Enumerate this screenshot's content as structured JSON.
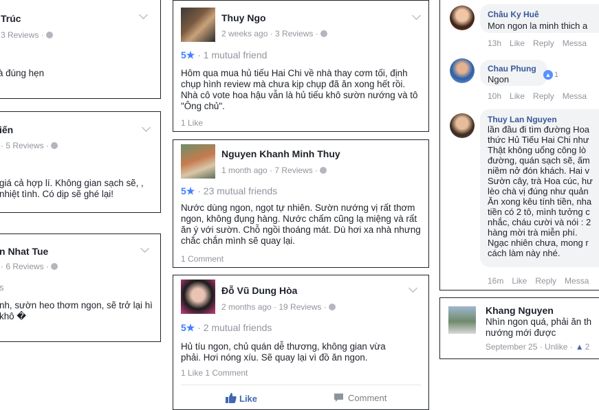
{
  "reviews_left": [
    {
      "name": "Trúc",
      "meta": "3 Reviews ·",
      "body": "à đúng hẹn"
    },
    {
      "name": "iến",
      "meta": "· 5 Reviews ·",
      "body": "giá cả hợp lí. Không gian sạch sẽ, , nhiệt tình. Có dịp sẽ ghé lại!"
    },
    {
      "name": "n Nhat Tue",
      "meta": "· 6 Reviews ·",
      "rating": "s",
      "body": "nh, sườn heo thơm ngon, sẽ trở lại hì khô �"
    }
  ],
  "reviews_mid": [
    {
      "name": "Thuy Ngo",
      "meta": "2 weeks ago · 3 Reviews ·",
      "score": "5★",
      "mutual": " · 1 mutual friend",
      "body": "Hôm qua mua hủ tiếu Hai Chi về nhà thay cơm tối, định chụp hình review mà chưa kịp chụp đã ăn xong hết rồi. Nhà cô vote hoa hậu vẫn là hủ tiếu khô sườn nướng và tô \"Ông chủ\".",
      "footer": "1 Like"
    },
    {
      "name": "Nguyen Khanh Minh Thuy",
      "meta": "1 month ago · 7 Reviews ·",
      "score": "5★",
      "mutual": " · 23 mutual friends",
      "body": "Nước dùng ngon, ngọt tự nhiên. Sườn nướng vị rất thơm ngon, không đụng hàng. Nước chấm cũng lạ miệng và rất ăn ý với sườn. Chỗ ngồi thoáng mát. Dù hơi xa nhà nhưng chắc chắn mình sẽ quay lại.",
      "footer": "1 Comment"
    },
    {
      "name": "Đỗ Vũ Dung Hòa",
      "meta": "2 months ago · 19 Reviews ·",
      "score": "5★",
      "mutual": " · 2 mutual friends",
      "body": "Hủ tíu ngon, chủ quán dễ thương, không gian vừa phải. Hơi nóng xíu. Sẽ quay lại vì đồ ăn ngon.",
      "footer": "1 Like  1 Comment",
      "like_label": "Like",
      "comment_label": "Comment"
    }
  ],
  "comments": [
    {
      "name": "Châu Ky Huê",
      "text": "Mon ngon la minh thich a",
      "time": "13h",
      "like": "Like",
      "reply": "Reply",
      "message": "Messa"
    },
    {
      "name": "Chau Phung",
      "text": "Ngon",
      "reactions": "1",
      "time": "10h",
      "like": "Like",
      "reply": "Reply",
      "message": "Messa"
    },
    {
      "name": "Thuy Lan Nguyen",
      "text": "lần đầu đi tìm đường Hoa thức Hủ Tiếu Hai Chi như Thật không uổng công lò đường, quán sạch sẽ, ấm niềm nở đón khách. Hai v Sườn cây, trà Hoa cúc, hư lèo chà vị đúng như quản Ăn xong kêu tính tiền, nha tiền có 2 tô, mình tưởng c nhắc, cháu cười và nói : 2 hàng mời trà miễn phí. Ngạc nhiên chưa, mong r cách làm này nhé.",
      "time": "16m",
      "like": "Like",
      "reply": "Reply",
      "message": "Messa"
    },
    {
      "name": "Khang Nguyen",
      "text": "Nhìn ngon quá, phải ăn th nướng mới được",
      "meta": "September 25 · Unlike ·",
      "likes": "2"
    }
  ]
}
